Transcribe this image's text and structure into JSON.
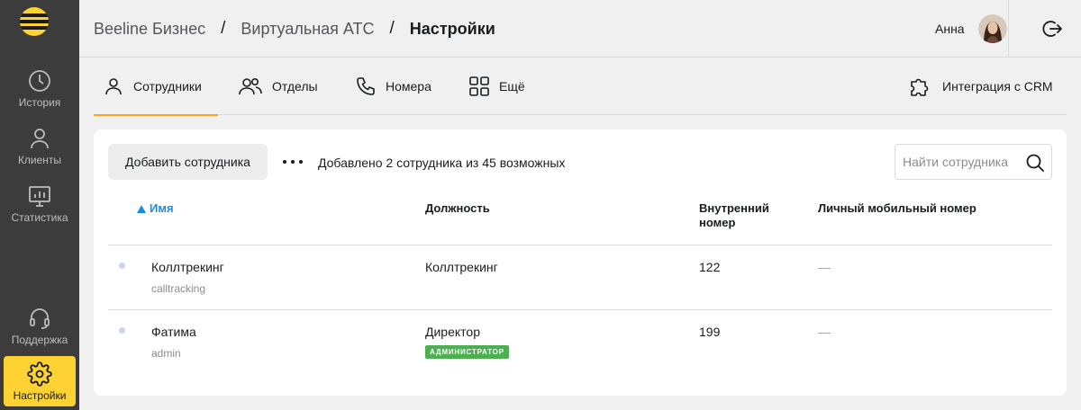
{
  "sidebar": {
    "items": [
      {
        "label": "История",
        "icon": "clock-icon"
      },
      {
        "label": "Клиенты",
        "icon": "person-icon"
      },
      {
        "label": "Статистика",
        "icon": "chart-monitor-icon"
      },
      {
        "label": "Поддержка",
        "icon": "headset-icon"
      },
      {
        "label": "Настройки",
        "icon": "gear-icon",
        "active": true
      }
    ]
  },
  "header": {
    "breadcrumb": [
      "Beeline Бизнес",
      "Виртуальная АТС",
      "Настройки"
    ],
    "separator": "/",
    "user_name": "Анна"
  },
  "tabs": [
    {
      "label": "Сотрудники",
      "icon": "person-icon",
      "active": true
    },
    {
      "label": "Отделы",
      "icon": "group-icon"
    },
    {
      "label": "Номера",
      "icon": "phone-icon"
    },
    {
      "label": "Ещё",
      "icon": "grid-icon"
    },
    {
      "label": "Интеграция с CRM",
      "icon": "puzzle-icon"
    }
  ],
  "toolbar": {
    "add_label": "Добавить сотрудника",
    "added_text": "Добавлено 2 сотрудника из 45 возможных",
    "search_placeholder": "Найти сотрудника"
  },
  "table": {
    "columns": [
      "Имя",
      "Должность",
      "Внутренний номер",
      "Личный мобильный номер"
    ],
    "rows": [
      {
        "name": "Коллтрекинг",
        "login": "calltracking",
        "position": "Коллтрекинг",
        "badge": "",
        "ext": "122",
        "mobile": "—"
      },
      {
        "name": "Фатима",
        "login": "admin",
        "position": "Директор",
        "badge": "АДМИНИСТРАТОР",
        "ext": "199",
        "mobile": "—"
      }
    ]
  },
  "colors": {
    "accent": "#ffd234",
    "tab_underline": "#f6a623",
    "sort_link": "#1a8ce5",
    "badge": "#4caf50",
    "sidebar_bg": "#3c3c3c"
  }
}
